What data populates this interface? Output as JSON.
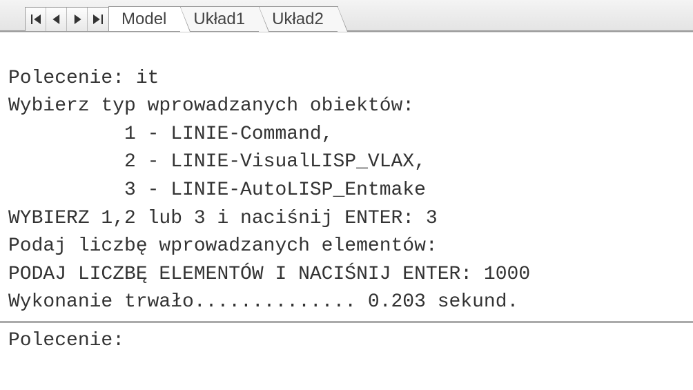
{
  "tabs": {
    "model": "Model",
    "layout1": "Układ1",
    "layout2": "Układ2"
  },
  "console": {
    "line1": "Polecenie: it",
    "line2": "Wybierz typ wprowadzanych obiektów:",
    "line3": "          1 - LINIE-Command,",
    "line4": "          2 - LINIE-VisualLISP_VLAX,",
    "line5": "          3 - LINIE-AutoLISP_Entmake",
    "line6": "WYBIERZ 1,2 lub 3 i naciśnij ENTER: 3",
    "line7": "Podaj liczbę wprowadzanych elementów:",
    "line8": "PODAJ LICZBĘ ELEMENTÓW I NACIŚNIJ ENTER: 1000",
    "line9": "Wykonanie trwało.............. 0.203 sekund."
  },
  "prompt": {
    "label": "Polecenie:",
    "value": ""
  }
}
